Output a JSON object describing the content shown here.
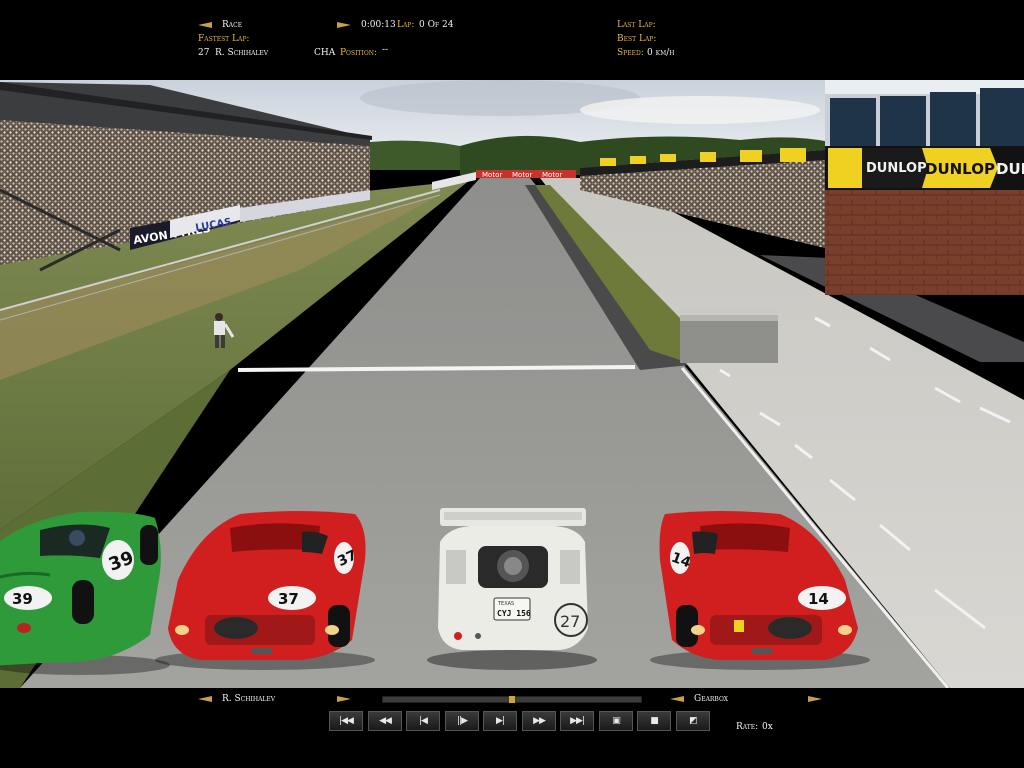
{
  "top_hud": {
    "race_label": "Race",
    "time": "0:00:13",
    "lap_label": "Lap:",
    "lap_value": "0 Of 24",
    "fastest_lap_label": "Fastest Lap:",
    "fastest_driver_number": "27",
    "fastest_driver_name": "R. Schihalev",
    "team": "CHA",
    "position_label": "Position:",
    "position_value": "--",
    "last_lap_label": "Last Lap:",
    "best_lap_label": "Best Lap:",
    "speed_label": "Speed:",
    "speed_value": "0 km/h"
  },
  "scene": {
    "banners": [
      "AVON TYRES",
      "LUCAS",
      "DUNLOP",
      "DUNLOP",
      "DUNLOP",
      "Motor",
      "Motor",
      "Motor"
    ],
    "cars": [
      {
        "number": "39",
        "color": "#2f9a3a"
      },
      {
        "number": "37",
        "color": "#d11f1f"
      },
      {
        "number": "27",
        "color": "#ecece6",
        "plate_top": "TEXAS",
        "plate": "CYJ 156"
      },
      {
        "number": "14",
        "color": "#d11f1f"
      }
    ]
  },
  "bottom_hud": {
    "driver_name": "R. Schihalev",
    "camera": "Gearbox",
    "rate_label": "Rate:",
    "rate_value": "0x",
    "replay_progress": 0.5,
    "buttons": [
      {
        "name": "skip-to-start",
        "glyph": "|◀◀"
      },
      {
        "name": "rewind",
        "glyph": "◀◀"
      },
      {
        "name": "step-back",
        "glyph": "|◀"
      },
      {
        "name": "pause",
        "glyph": "||▶"
      },
      {
        "name": "step-forward",
        "glyph": "▶|"
      },
      {
        "name": "fast-forward",
        "glyph": "▶▶"
      },
      {
        "name": "skip-to-end",
        "glyph": "▶▶|"
      },
      {
        "name": "camera",
        "glyph": "▣"
      },
      {
        "name": "stop",
        "glyph": "■"
      },
      {
        "name": "exit",
        "glyph": "◩"
      }
    ]
  }
}
